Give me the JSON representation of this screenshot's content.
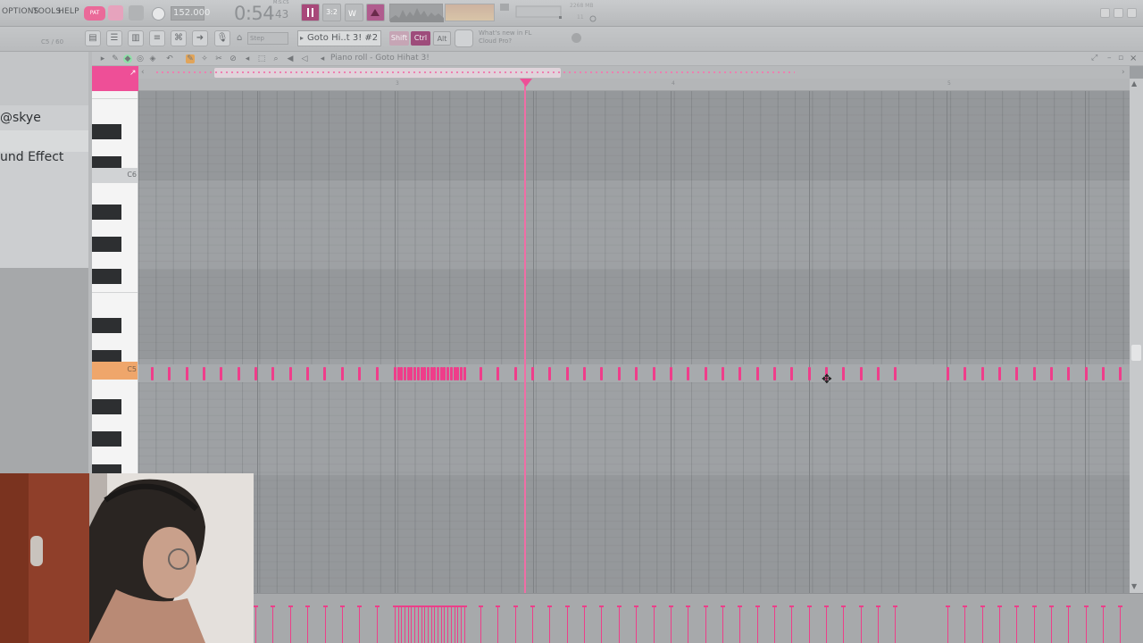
{
  "menu": {
    "options": "OPTIONS",
    "tools": "TOOLS",
    "help": "HELP"
  },
  "transport": {
    "pattern_label": "PAT",
    "tempo": "152.000",
    "time": "0:54",
    "time_fraction": "43",
    "time_unit": "M:S:CS",
    "mode_32": "3:2"
  },
  "system": {
    "memory": "2268 MB",
    "cpu": "11"
  },
  "toolbar2": {
    "note_label": "C5 / 60",
    "snap": "Step",
    "pattern_name": "Goto Hi..t 3! #2",
    "shift": "Shift",
    "ctrl": "Ctrl",
    "alt": "Alt",
    "news_line1": "What's new in FL",
    "news_line2": "Cloud Pro?"
  },
  "browser": {
    "item1": "@skye",
    "item2": "und Effect"
  },
  "piano_roll": {
    "title": "Piano roll - Goto Hihat 3!",
    "bars": [
      "3",
      "4",
      "5"
    ],
    "key_c6": "C6",
    "key_c5": "C5"
  },
  "colors": {
    "note": "#ef3d8a",
    "accent": "#ee4f97",
    "key_highlight": "#efa66b"
  }
}
